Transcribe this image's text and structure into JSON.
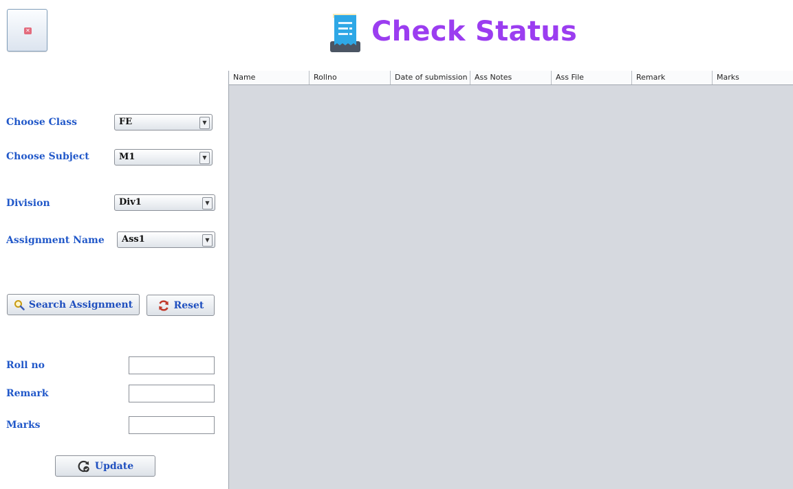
{
  "header": {
    "title": "Check Status",
    "close_icon": "close-icon",
    "title_icon": "receipt-icon"
  },
  "form": {
    "class_label": "Choose Class",
    "class_value": "FE",
    "subject_label": "Choose Subject",
    "subject_value": "M1",
    "division_label": "Division",
    "division_value": "Div1",
    "assignment_label": "Assignment Name",
    "assignment_value": "Ass1",
    "search_button": "Search Assignment",
    "reset_button": "Reset",
    "rollno_label": "Roll no",
    "rollno_value": "",
    "remark_label": "Remark",
    "remark_value": "",
    "marks_label": "Marks",
    "marks_value": "",
    "update_button": "Update"
  },
  "table": {
    "columns": [
      "Name",
      "Rollno",
      "Date of submission",
      "Ass Notes",
      "Ass File",
      "Remark",
      "Marks"
    ],
    "rows": []
  },
  "colors": {
    "title": "#9b3df0",
    "label": "#2158c9",
    "table_bg": "#d6d9df"
  }
}
